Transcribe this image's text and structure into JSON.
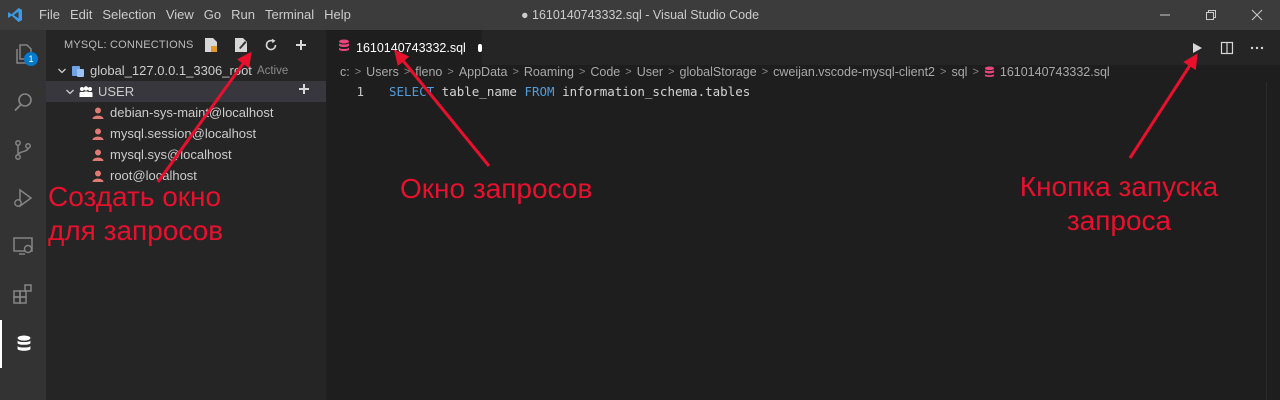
{
  "titlebar": {
    "menu": [
      "File",
      "Edit",
      "Selection",
      "View",
      "Go",
      "Run",
      "Terminal",
      "Help"
    ],
    "window_title": "● 1610140743332.sql - Visual Studio Code"
  },
  "activitybar": {
    "badge_count": "1"
  },
  "sidebar": {
    "title": "MYSQL: CONNECTIONS",
    "connection": {
      "label": "global_127.0.0.1_3306_root",
      "description": "Active"
    },
    "group": {
      "label": "USER"
    },
    "users": [
      "debian-sys-maint@localhost",
      "mysql.session@localhost",
      "mysql.sys@localhost",
      "root@localhost"
    ]
  },
  "editor": {
    "tab_label": "1610140743332.sql",
    "breadcrumb": [
      "c:",
      "Users",
      "fleno",
      "AppData",
      "Roaming",
      "Code",
      "User",
      "globalStorage",
      "cweijan.vscode-mysql-client2",
      "sql",
      "1610140743332.sql"
    ],
    "line_number": "1",
    "code": {
      "kw1": "SELECT",
      "part1": " table_name ",
      "kw2": "FROM",
      "part2": " information_schema.tables"
    }
  },
  "annotations": {
    "create_window": [
      "Создать окно",
      "для запросов"
    ],
    "query_window": "Окно запросов",
    "run_button": [
      "Кнопка запуска",
      "запроса"
    ]
  },
  "colors": {
    "accent": "#007acc",
    "annotation": "#e8112d",
    "keyword": "#569cd6",
    "file_icon": "#e8467c"
  }
}
